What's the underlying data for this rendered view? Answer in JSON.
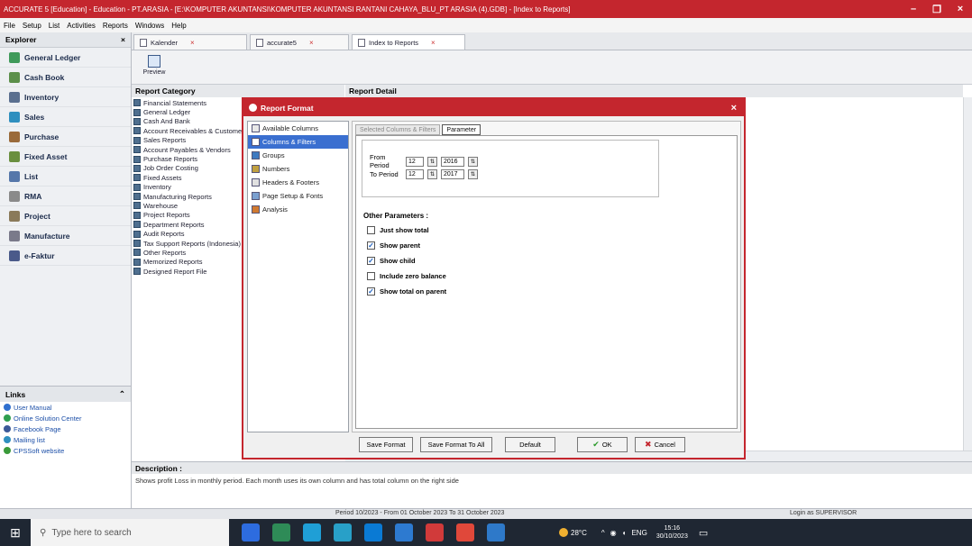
{
  "window": {
    "title": "ACCURATE 5 [Education] - Education - PT.ARASIA - [E:\\KOMPUTER AKUNTANSI\\KOMPUTER AKUNTANSI RANTANI CAHAYA_BLU_PT ARASIA (4).GDB] - [Index to Reports]",
    "minimize": "–",
    "restore": "❐",
    "close": "×"
  },
  "menu": [
    "File",
    "Setup",
    "List",
    "Activities",
    "Reports",
    "Windows",
    "Help"
  ],
  "explorer": {
    "title": "Explorer",
    "close": "×",
    "items": [
      {
        "label": "General Ledger",
        "color": "#3f9a5a"
      },
      {
        "label": "Cash Book",
        "color": "#5b8f4a"
      },
      {
        "label": "Inventory",
        "color": "#5a6f8f"
      },
      {
        "label": "Sales",
        "color": "#2f8fbf"
      },
      {
        "label": "Purchase",
        "color": "#9a6a3a"
      },
      {
        "label": "Fixed Asset",
        "color": "#6a8f3f"
      },
      {
        "label": "List",
        "color": "#5577aa"
      },
      {
        "label": "RMA",
        "color": "#8a8a8a"
      },
      {
        "label": "Project",
        "color": "#8a7a5a"
      },
      {
        "label": "Manufacture",
        "color": "#7a7a8a"
      },
      {
        "label": "e-Faktur",
        "color": "#4a5a8a"
      }
    ],
    "links_title": "Links",
    "links_collapse": "⌃",
    "links": [
      {
        "label": "User Manual",
        "color": "#2f6fcf"
      },
      {
        "label": "Online Solution Center",
        "color": "#2f9f4f"
      },
      {
        "label": "Facebook Page",
        "color": "#3b5998"
      },
      {
        "label": "Mailing list",
        "color": "#2f8fbf"
      },
      {
        "label": "CPSSoft website",
        "color": "#3a9a3a"
      }
    ]
  },
  "tabs": [
    {
      "label": "Kalender",
      "close": "×"
    },
    {
      "label": "accurate5",
      "close": "×"
    },
    {
      "label": "Index to Reports",
      "close": "×"
    }
  ],
  "toolbar": {
    "preview": "Preview"
  },
  "report": {
    "category_title": "Report Category",
    "detail_title": "Report Detail",
    "categories": [
      "Financial Statements",
      "General Ledger",
      "Cash And Bank",
      "Account Receivables & Customers",
      "Sales Reports",
      "Account Payables & Vendors",
      "Purchase Reports",
      "Job Order Costing",
      "Fixed Assets",
      "Inventory",
      "Manufacturing Reports",
      "Warehouse",
      "Project Reports",
      "Department Reports",
      "Audit Reports",
      "Tax Support Reports (Indonesia)",
      "Other Reports",
      "Memorized Reports",
      "Designed Report File"
    ]
  },
  "description": {
    "title": "Description :",
    "text": "Shows profit Loss in monthly period. Each month uses its own column and has total column on the right side"
  },
  "status": {
    "period": "Period 10/2023 - From 01 October 2023 To 31 October 2023",
    "login": "Login as SUPERVISOR"
  },
  "dialog": {
    "title": "Report Format",
    "close": "×",
    "nav": [
      {
        "label": "Available Columns",
        "color": "#e8e8e8"
      },
      {
        "label": "Columns & Filters",
        "color": "#ffffff"
      },
      {
        "label": "Groups",
        "color": "#3f7ac0"
      },
      {
        "label": "Numbers",
        "color": "#c0a040"
      },
      {
        "label": "Headers & Footers",
        "color": "#e0e0e0"
      },
      {
        "label": "Page Setup & Fonts",
        "color": "#7aa0d0"
      },
      {
        "label": "Analysis",
        "color": "#d07a30"
      }
    ],
    "subtabs": [
      "Selected Columns & Filters",
      "Parameter"
    ],
    "from_label": "From Period",
    "from_month": "12",
    "from_year": "2016",
    "to_label": "To Period",
    "to_month": "12",
    "to_year": "2017",
    "spin_icon": "⇅",
    "other_title": "Other Parameters :",
    "options": [
      {
        "label": "Just show total",
        "checked": false
      },
      {
        "label": "Show parent",
        "checked": true
      },
      {
        "label": "Show child",
        "checked": true
      },
      {
        "label": "Include zero balance",
        "checked": false
      },
      {
        "label": "Show total on parent",
        "checked": true
      }
    ],
    "check_mark": "✓",
    "buttons": {
      "save_format": "Save Format",
      "save_format_all": "Save Format To All",
      "default": "Default",
      "ok": "OK",
      "ok_icon": "✔",
      "cancel": "Cancel",
      "cancel_icon": "✖"
    }
  },
  "taskbar": {
    "start_icon": "⊞",
    "search_placeholder": "Type here to search",
    "search_icon": "⚲",
    "temperature": "28°C",
    "lang": "ENG",
    "time": "15:16",
    "date": "30/10/2023",
    "app_colors": [
      "#2d6cdf",
      "#2e8b57",
      "#1f9fd6",
      "#28a0c8",
      "#0a7ad4",
      "#2d7ad0",
      "#d13a3a",
      "#e0483a",
      "#2e79c9"
    ]
  }
}
